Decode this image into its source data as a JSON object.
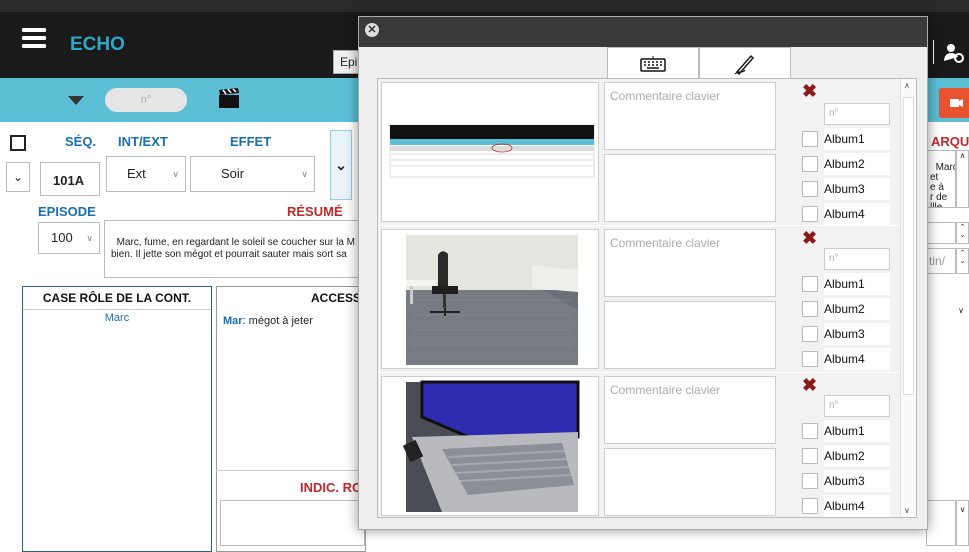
{
  "app": {
    "title": "ECHO",
    "epi_button": "Epi."
  },
  "toolbar": {
    "number_placeholder": "n°"
  },
  "labels": {
    "seq": "SÉQ.",
    "intext": "INT/EXT",
    "effet": "EFFET",
    "episode": "EPISODE",
    "resume": "RÉSUMÉ",
    "marque": "ARQU",
    "case_role": "CASE RÔLE DE LA CONT.",
    "accessoires": "ACCESS",
    "indic": "INDIC. RO"
  },
  "scene": {
    "seq": "101A",
    "intext": "Ext",
    "effet": "Soir",
    "episode": "100",
    "resume": "Marc, fume, en regardant le soleil se coucher sur la M\nbien. Il jette son mégot et pourrait sauter mais sort sa",
    "right_note": "Marc\net\ne à\nr de\nllle",
    "right_field": "tin/"
  },
  "roles": [
    {
      "name": "Marc"
    }
  ],
  "accessoires": {
    "prefix": "Mar",
    "text": ": mégot à jeter"
  },
  "photo_dialog": {
    "comment_placeholder": "Commentaire clavier",
    "number_placeholder": "n°",
    "albums": [
      "Album1",
      "Album2",
      "Album3",
      "Album4"
    ],
    "rows": [
      {
        "image": "app-screenshot-thumbnail"
      },
      {
        "image": "office-room-photo"
      },
      {
        "image": "laptop-photo"
      }
    ]
  },
  "colors": {
    "teal": "#5cbfd6",
    "brand": "#2ea7c8",
    "heading_blue": "#1a6fb0",
    "heading_red": "#c0272d",
    "delete": "#8b1a1a",
    "record": "#e8522e"
  }
}
